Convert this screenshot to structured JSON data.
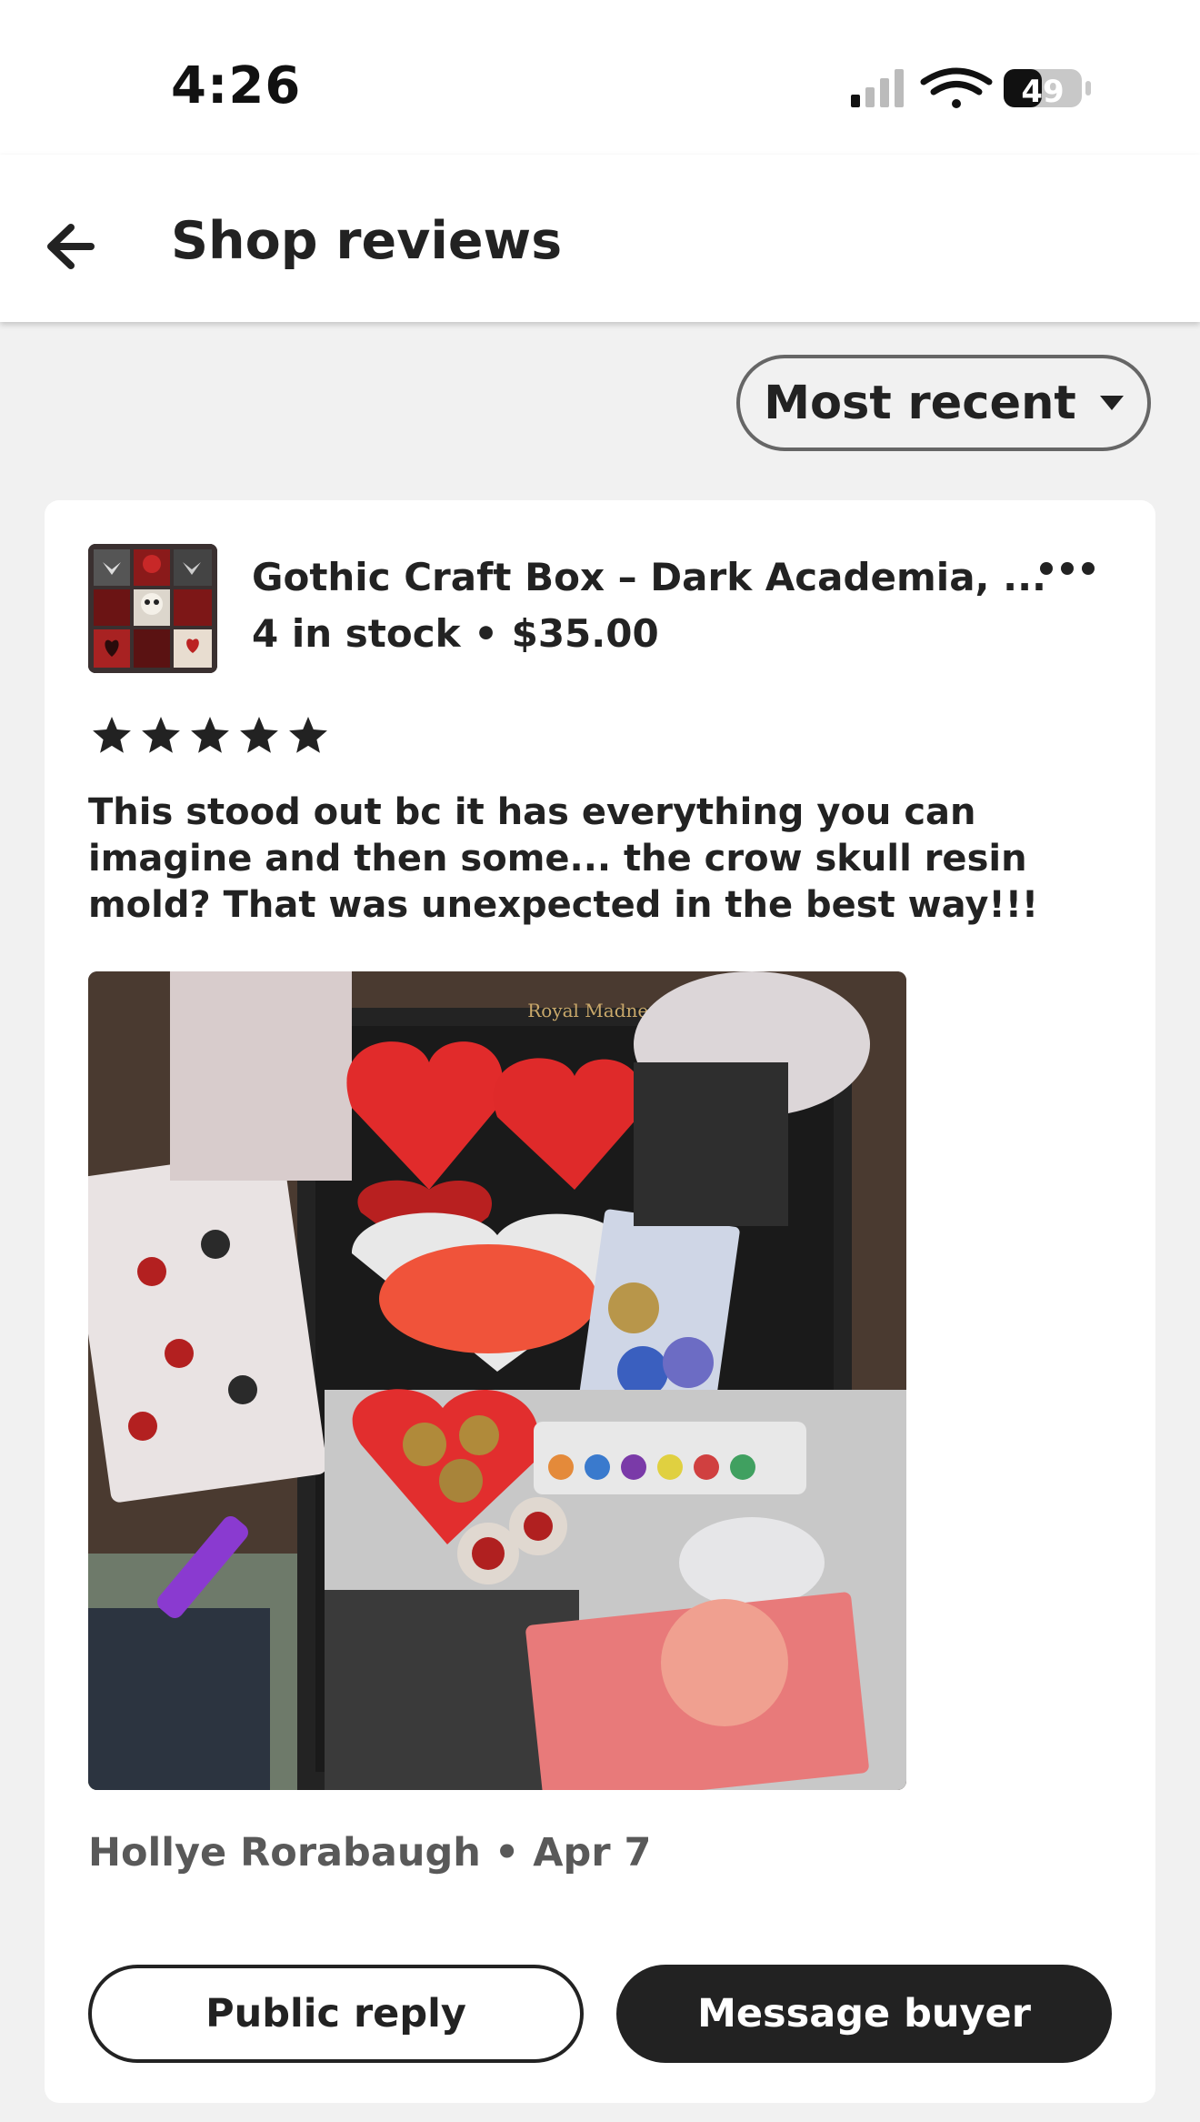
{
  "status_bar": {
    "time": "4:26",
    "battery_level": "49",
    "icons": [
      "cellular-signal-icon",
      "wifi-icon",
      "battery-icon"
    ]
  },
  "header": {
    "title": "Shop reviews",
    "back_icon": "arrow-left-icon"
  },
  "sort": {
    "label": "Most recent",
    "icon": "caret-down-icon"
  },
  "review": {
    "listing_title": "Gothic Craft Box – Dark Academia, ...",
    "listing_meta": "4 in stock • $35.00",
    "more_icon": "more-horizontal-icon",
    "rating": 5,
    "rating_max": 5,
    "text": "This stood out bc it has everything you can imagine and then some... the crow skull resin mold? That was unexpected in the best way!!!",
    "photo_text": "Royal Madness",
    "reviewer": "Hollye Rorabaugh • Apr 7",
    "public_reply_label": "Public reply",
    "message_buyer_label": "Message buyer"
  }
}
